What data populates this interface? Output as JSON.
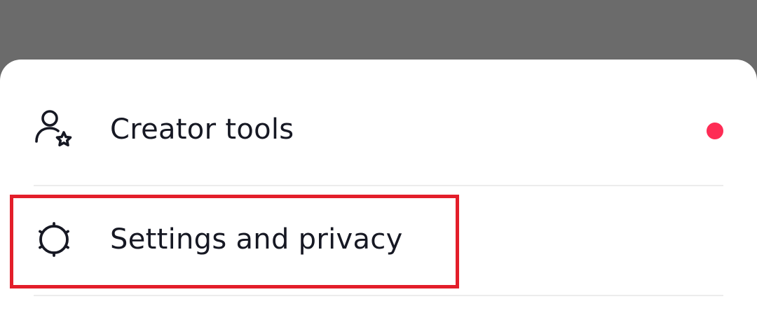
{
  "menu": {
    "items": [
      {
        "label": "Creator tools",
        "icon": "person-star-icon",
        "has_notification_dot": true
      },
      {
        "label": "Settings and privacy",
        "icon": "gear-icon",
        "highlighted": true
      }
    ]
  },
  "colors": {
    "notification_dot": "#fe2c55",
    "highlight_border": "#e31e2a",
    "text": "#161823",
    "scrim": "#6b6b6b"
  }
}
